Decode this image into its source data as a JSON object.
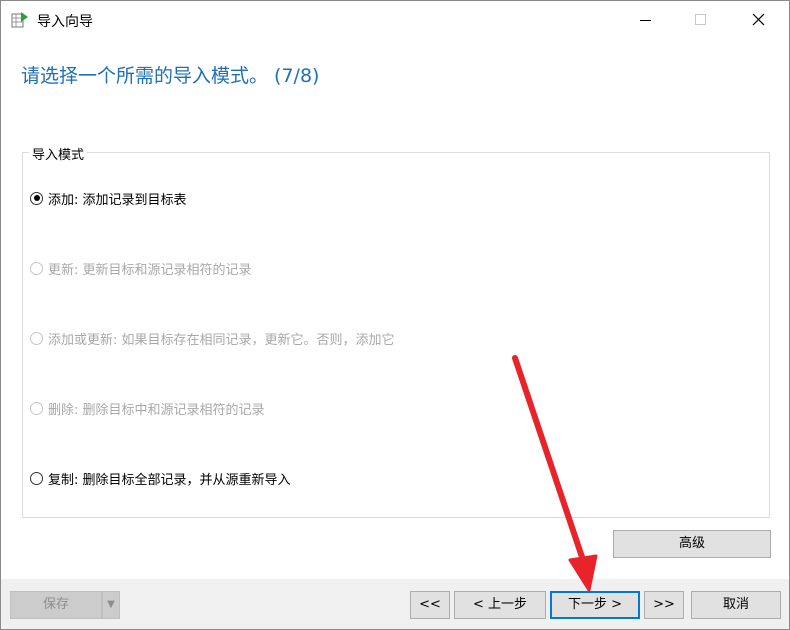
{
  "window": {
    "title": "导入向导",
    "icon": "import-wizard-icon"
  },
  "heading": "请选择一个所需的导入模式。 (7/8)",
  "group": {
    "legend": "导入模式",
    "options": [
      {
        "label": "添加: 添加记录到目标表",
        "checked": true,
        "enabled": true
      },
      {
        "label": "更新: 更新目标和源记录相符的记录",
        "checked": false,
        "enabled": false
      },
      {
        "label": "添加或更新: 如果目标存在相同记录，更新它。否则，添加它",
        "checked": false,
        "enabled": false
      },
      {
        "label": "删除: 删除目标中和源记录相符的记录",
        "checked": false,
        "enabled": false
      },
      {
        "label": "复制: 删除目标全部记录，并从源重新导入",
        "checked": false,
        "enabled": true
      }
    ]
  },
  "buttons": {
    "advanced": "高级",
    "save": "保存",
    "first": "<<",
    "prev": "< 上一步",
    "next": "下一步 >",
    "last": ">>",
    "cancel": "取消"
  },
  "annotation": {
    "arrow_color": "#e8232a"
  }
}
